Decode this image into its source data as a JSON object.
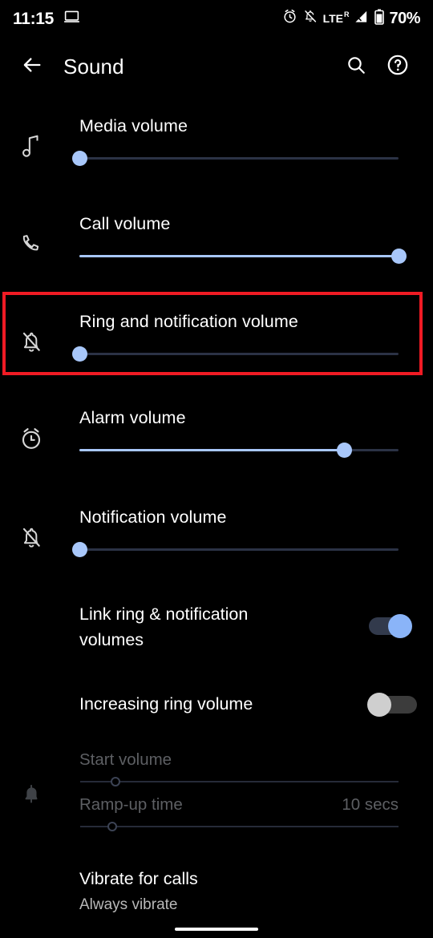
{
  "statusbar": {
    "time": "11:15",
    "cast_icon": "laptop-icon",
    "alarm_icon": "alarm-clock-icon",
    "notifications_off_icon": "bell-slash-icon",
    "network_type": "LTE",
    "network_roaming": "R",
    "signal_icon": "signal-bars-icon",
    "battery_icon": "battery-icon",
    "battery_level": "70%"
  },
  "appbar": {
    "back_icon": "arrow-back-icon",
    "title": "Sound",
    "search_icon": "search-icon",
    "help_icon": "help-circle-icon"
  },
  "sliders": [
    {
      "id": "media-volume",
      "label": "Media volume",
      "icon": "music-note-icon",
      "percent": 0
    },
    {
      "id": "call-volume",
      "label": "Call volume",
      "icon": "phone-icon",
      "percent": 100
    },
    {
      "id": "ring-and-notification-volume",
      "label": "Ring and notification volume",
      "icon": "bell-slash-icon",
      "percent": 0,
      "highlighted": true
    },
    {
      "id": "alarm-volume",
      "label": "Alarm volume",
      "icon": "alarm-clock-icon",
      "percent": 83
    },
    {
      "id": "notification-volume",
      "label": "Notification volume",
      "icon": "bell-slash-icon",
      "percent": 0
    }
  ],
  "switches": [
    {
      "id": "link-ring-notification-volumes",
      "label": "Link ring & notification volumes",
      "state": "on"
    },
    {
      "id": "increasing-ring-volume",
      "label": "Increasing ring volume",
      "state": "off"
    }
  ],
  "increasing_ring_settings": {
    "icon": "bell-icon",
    "disabled": true,
    "start_volume": {
      "label": "Start volume",
      "percent": 11
    },
    "ramp_up_time": {
      "label": "Ramp-up time",
      "value": "10 secs",
      "percent": 10
    }
  },
  "vibrate_for_calls": {
    "title": "Vibrate for calls",
    "subtitle": "Always vibrate"
  },
  "navbar": {
    "gesture_pill": "home-gesture-pill"
  },
  "colors": {
    "background": "#000000",
    "accent": "#a8c7fa",
    "switch_on_thumb": "#8ab4f8",
    "highlight_border": "#f01b24",
    "inactive_track": "#2b3245",
    "disabled_text": "#5d5f63"
  }
}
